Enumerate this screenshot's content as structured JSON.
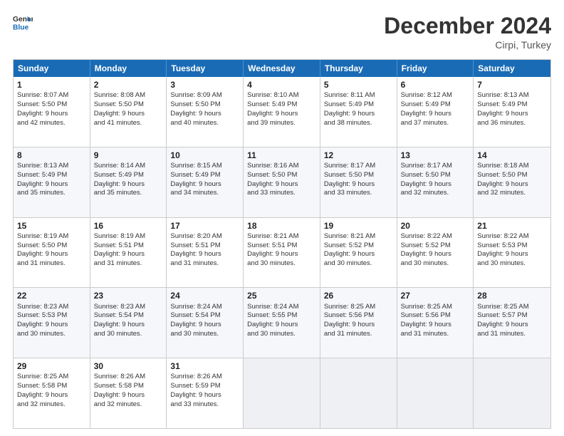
{
  "header": {
    "logo_general": "General",
    "logo_blue": "Blue",
    "month_title": "December 2024",
    "location": "Cirpi, Turkey"
  },
  "days_of_week": [
    "Sunday",
    "Monday",
    "Tuesday",
    "Wednesday",
    "Thursday",
    "Friday",
    "Saturday"
  ],
  "weeks": [
    [
      {
        "day": "1",
        "lines": [
          "Sunrise: 8:07 AM",
          "Sunset: 5:50 PM",
          "Daylight: 9 hours",
          "and 42 minutes."
        ]
      },
      {
        "day": "2",
        "lines": [
          "Sunrise: 8:08 AM",
          "Sunset: 5:50 PM",
          "Daylight: 9 hours",
          "and 41 minutes."
        ]
      },
      {
        "day": "3",
        "lines": [
          "Sunrise: 8:09 AM",
          "Sunset: 5:50 PM",
          "Daylight: 9 hours",
          "and 40 minutes."
        ]
      },
      {
        "day": "4",
        "lines": [
          "Sunrise: 8:10 AM",
          "Sunset: 5:49 PM",
          "Daylight: 9 hours",
          "and 39 minutes."
        ]
      },
      {
        "day": "5",
        "lines": [
          "Sunrise: 8:11 AM",
          "Sunset: 5:49 PM",
          "Daylight: 9 hours",
          "and 38 minutes."
        ]
      },
      {
        "day": "6",
        "lines": [
          "Sunrise: 8:12 AM",
          "Sunset: 5:49 PM",
          "Daylight: 9 hours",
          "and 37 minutes."
        ]
      },
      {
        "day": "7",
        "lines": [
          "Sunrise: 8:13 AM",
          "Sunset: 5:49 PM",
          "Daylight: 9 hours",
          "and 36 minutes."
        ]
      }
    ],
    [
      {
        "day": "8",
        "lines": [
          "Sunrise: 8:13 AM",
          "Sunset: 5:49 PM",
          "Daylight: 9 hours",
          "and 35 minutes."
        ]
      },
      {
        "day": "9",
        "lines": [
          "Sunrise: 8:14 AM",
          "Sunset: 5:49 PM",
          "Daylight: 9 hours",
          "and 35 minutes."
        ]
      },
      {
        "day": "10",
        "lines": [
          "Sunrise: 8:15 AM",
          "Sunset: 5:49 PM",
          "Daylight: 9 hours",
          "and 34 minutes."
        ]
      },
      {
        "day": "11",
        "lines": [
          "Sunrise: 8:16 AM",
          "Sunset: 5:50 PM",
          "Daylight: 9 hours",
          "and 33 minutes."
        ]
      },
      {
        "day": "12",
        "lines": [
          "Sunrise: 8:17 AM",
          "Sunset: 5:50 PM",
          "Daylight: 9 hours",
          "and 33 minutes."
        ]
      },
      {
        "day": "13",
        "lines": [
          "Sunrise: 8:17 AM",
          "Sunset: 5:50 PM",
          "Daylight: 9 hours",
          "and 32 minutes."
        ]
      },
      {
        "day": "14",
        "lines": [
          "Sunrise: 8:18 AM",
          "Sunset: 5:50 PM",
          "Daylight: 9 hours",
          "and 32 minutes."
        ]
      }
    ],
    [
      {
        "day": "15",
        "lines": [
          "Sunrise: 8:19 AM",
          "Sunset: 5:50 PM",
          "Daylight: 9 hours",
          "and 31 minutes."
        ]
      },
      {
        "day": "16",
        "lines": [
          "Sunrise: 8:19 AM",
          "Sunset: 5:51 PM",
          "Daylight: 9 hours",
          "and 31 minutes."
        ]
      },
      {
        "day": "17",
        "lines": [
          "Sunrise: 8:20 AM",
          "Sunset: 5:51 PM",
          "Daylight: 9 hours",
          "and 31 minutes."
        ]
      },
      {
        "day": "18",
        "lines": [
          "Sunrise: 8:21 AM",
          "Sunset: 5:51 PM",
          "Daylight: 9 hours",
          "and 30 minutes."
        ]
      },
      {
        "day": "19",
        "lines": [
          "Sunrise: 8:21 AM",
          "Sunset: 5:52 PM",
          "Daylight: 9 hours",
          "and 30 minutes."
        ]
      },
      {
        "day": "20",
        "lines": [
          "Sunrise: 8:22 AM",
          "Sunset: 5:52 PM",
          "Daylight: 9 hours",
          "and 30 minutes."
        ]
      },
      {
        "day": "21",
        "lines": [
          "Sunrise: 8:22 AM",
          "Sunset: 5:53 PM",
          "Daylight: 9 hours",
          "and 30 minutes."
        ]
      }
    ],
    [
      {
        "day": "22",
        "lines": [
          "Sunrise: 8:23 AM",
          "Sunset: 5:53 PM",
          "Daylight: 9 hours",
          "and 30 minutes."
        ]
      },
      {
        "day": "23",
        "lines": [
          "Sunrise: 8:23 AM",
          "Sunset: 5:54 PM",
          "Daylight: 9 hours",
          "and 30 minutes."
        ]
      },
      {
        "day": "24",
        "lines": [
          "Sunrise: 8:24 AM",
          "Sunset: 5:54 PM",
          "Daylight: 9 hours",
          "and 30 minutes."
        ]
      },
      {
        "day": "25",
        "lines": [
          "Sunrise: 8:24 AM",
          "Sunset: 5:55 PM",
          "Daylight: 9 hours",
          "and 30 minutes."
        ]
      },
      {
        "day": "26",
        "lines": [
          "Sunrise: 8:25 AM",
          "Sunset: 5:56 PM",
          "Daylight: 9 hours",
          "and 31 minutes."
        ]
      },
      {
        "day": "27",
        "lines": [
          "Sunrise: 8:25 AM",
          "Sunset: 5:56 PM",
          "Daylight: 9 hours",
          "and 31 minutes."
        ]
      },
      {
        "day": "28",
        "lines": [
          "Sunrise: 8:25 AM",
          "Sunset: 5:57 PM",
          "Daylight: 9 hours",
          "and 31 minutes."
        ]
      }
    ],
    [
      {
        "day": "29",
        "lines": [
          "Sunrise: 8:25 AM",
          "Sunset: 5:58 PM",
          "Daylight: 9 hours",
          "and 32 minutes."
        ]
      },
      {
        "day": "30",
        "lines": [
          "Sunrise: 8:26 AM",
          "Sunset: 5:58 PM",
          "Daylight: 9 hours",
          "and 32 minutes."
        ]
      },
      {
        "day": "31",
        "lines": [
          "Sunrise: 8:26 AM",
          "Sunset: 5:59 PM",
          "Daylight: 9 hours",
          "and 33 minutes."
        ]
      },
      {
        "day": "",
        "lines": []
      },
      {
        "day": "",
        "lines": []
      },
      {
        "day": "",
        "lines": []
      },
      {
        "day": "",
        "lines": []
      }
    ]
  ]
}
